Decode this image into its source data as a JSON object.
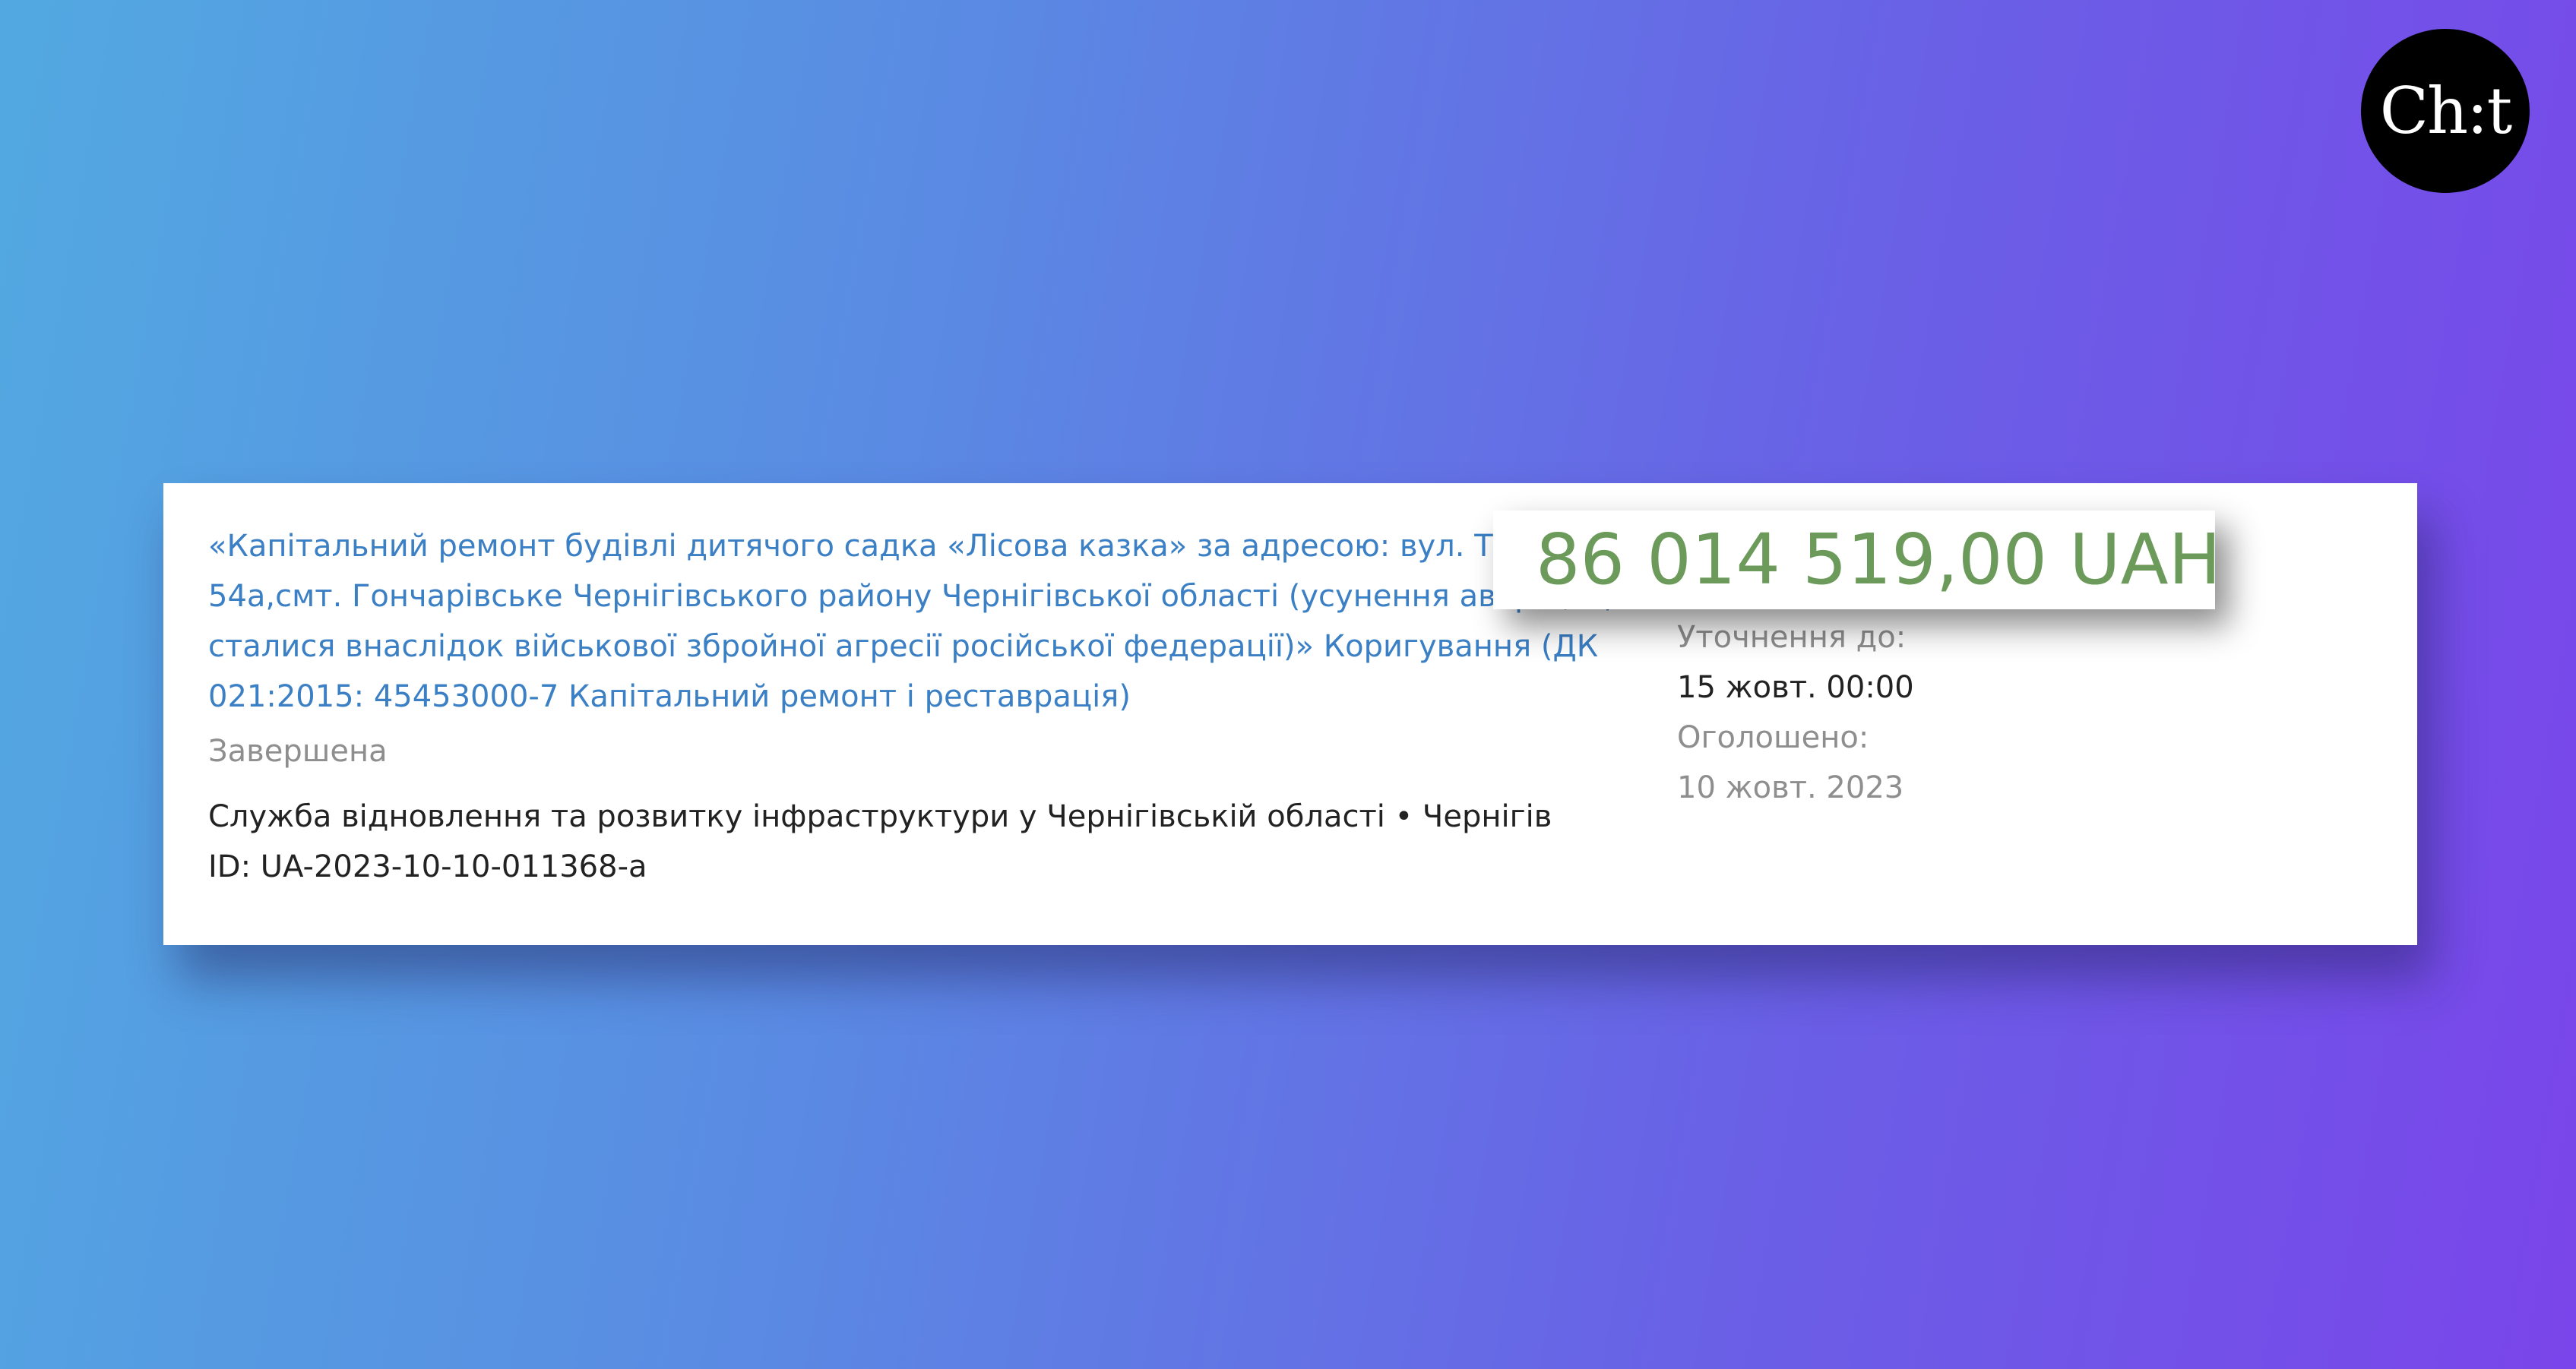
{
  "brand": {
    "logo_text": "Ch:t"
  },
  "tender": {
    "title": "«Капітальний ремонт будівлі дитячого садка «Лісова казка» за адресою: вул. Танкістів, 54а,смт. Гончарівське Чернігівського району Чернігівської області (усунення аварій, що сталися внаслідок військової збройної агресії російської федерації)» Коригування (ДК 021:2015: 45453000-7 Капітальний ремонт і реставрація)",
    "status": "Завершена",
    "organization": "Служба відновлення та розвитку інфраструктури у Чернігівській області • Чернігів",
    "id_text": "ID: UA-2023-10-10-011368-a",
    "amount": "86 014 519,00 UAH",
    "clarification_label": "Уточнення до:",
    "clarification_value": "15 жовт. 00:00",
    "announced_label": "Оголошено:",
    "announced_value": "10 жовт. 2023"
  },
  "colors": {
    "link": "#3b7fc4",
    "amount": "#6b9a5b",
    "muted": "#8e8e8e"
  }
}
